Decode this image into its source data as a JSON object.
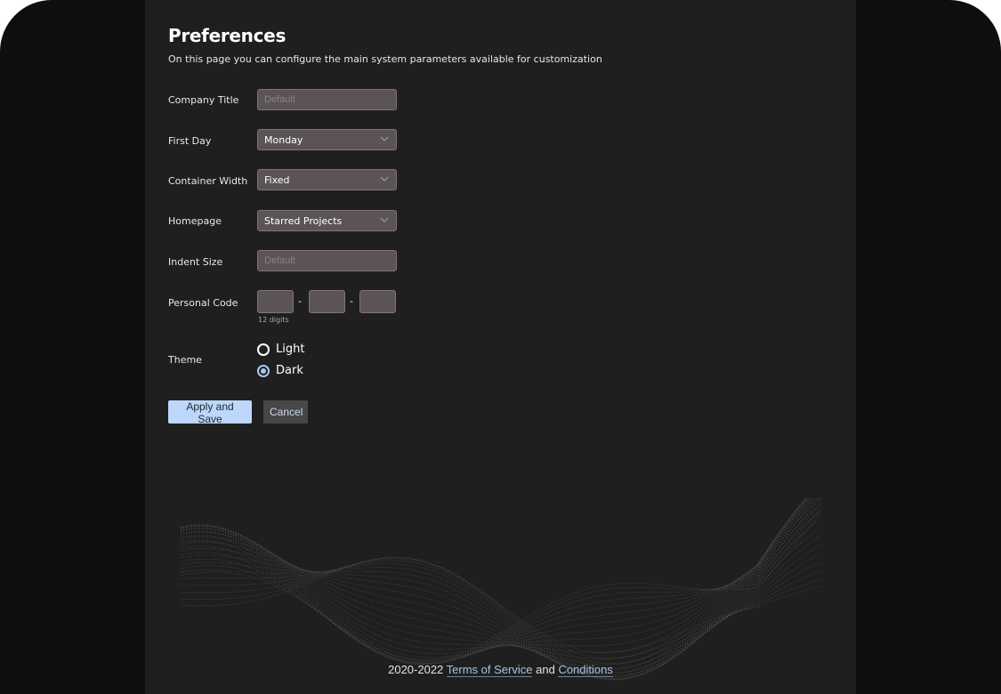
{
  "page": {
    "title": "Preferences",
    "subtitle": "On this page you can configure the main system parameters available for customization"
  },
  "form": {
    "company_title": {
      "label": "Company Title",
      "placeholder": "Default",
      "value": ""
    },
    "first_day": {
      "label": "First Day",
      "value": "Monday"
    },
    "container_width": {
      "label": "Container Width",
      "value": "Fixed"
    },
    "homepage": {
      "label": "Homepage",
      "value": "Starred Projects"
    },
    "indent_size": {
      "label": "Indent Size",
      "placeholder": "Default",
      "value": ""
    },
    "personal_code": {
      "label": "Personal Code",
      "hint": "12 digits",
      "separator": "-",
      "parts": [
        "",
        "",
        ""
      ]
    },
    "theme": {
      "label": "Theme",
      "options": [
        {
          "label": "Light",
          "checked": false
        },
        {
          "label": "Dark",
          "checked": true
        }
      ]
    }
  },
  "actions": {
    "apply_label": "Apply and Save",
    "cancel_label": "Cancel"
  },
  "footer": {
    "years": "2020-2022",
    "terms_link": "Terms of Service",
    "and_text": "and",
    "conditions_link": "Conditions"
  },
  "icons": {
    "select_arrow": "chevron-down-icon"
  },
  "colors": {
    "background": "#0d0f0e",
    "panel": "#1f1f1f",
    "field": "#5b5354",
    "accent": "#bcd7fb",
    "link": "#a4c4ec"
  }
}
